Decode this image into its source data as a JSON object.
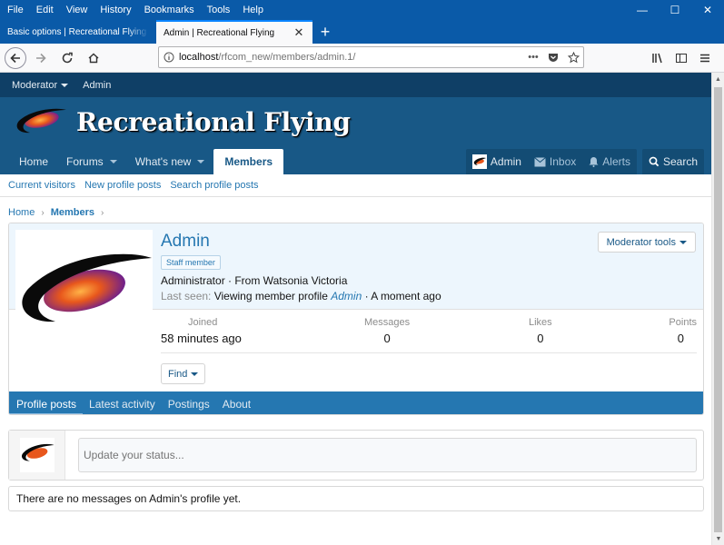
{
  "browser": {
    "menu": [
      "File",
      "Edit",
      "View",
      "History",
      "Bookmarks",
      "Tools",
      "Help"
    ],
    "tabs": [
      {
        "title": "Basic options | Recreational Flying -",
        "active": false
      },
      {
        "title": "Admin | Recreational Flying",
        "active": true
      }
    ],
    "url_host": "localhost",
    "url_path": "/rfcom_new/members/admin.1/"
  },
  "site": {
    "staff_bar": {
      "moderator": "Moderator",
      "admin": "Admin"
    },
    "title": "Recreational Flying",
    "nav": [
      {
        "label": "Home",
        "caret": false,
        "active": false
      },
      {
        "label": "Forums",
        "caret": true,
        "active": false
      },
      {
        "label": "What's new",
        "caret": true,
        "active": false
      },
      {
        "label": "Members",
        "caret": false,
        "active": true
      }
    ],
    "user_nav": {
      "admin": "Admin",
      "inbox": "Inbox",
      "alerts": "Alerts",
      "search": "Search"
    },
    "subnav": [
      "Current visitors",
      "New profile posts",
      "Search profile posts"
    ],
    "breadcrumb": [
      "Home",
      "Members"
    ]
  },
  "profile": {
    "name": "Admin",
    "badge": "Staff member",
    "line1": "Administrator · From Watsonia Victoria",
    "last_seen_label": "Last seen:",
    "last_seen_activity": "Viewing member profile",
    "last_seen_link": "Admin",
    "last_seen_time": "· A moment ago",
    "moderator_tools": "Moderator tools",
    "stats": {
      "joined_label": "Joined",
      "joined_value": "58 minutes ago",
      "messages_label": "Messages",
      "messages_value": "0",
      "likes_label": "Likes",
      "likes_value": "0",
      "points_label": "Points",
      "points_value": "0"
    },
    "find": "Find",
    "tabs": [
      "Profile posts",
      "Latest activity",
      "Postings",
      "About"
    ]
  },
  "status": {
    "placeholder": "Update your status..."
  },
  "empty_message": "There are no messages on Admin's profile yet.",
  "colors": {
    "header": "#185886",
    "staff_bar": "#0f3f66",
    "link": "#2577b1",
    "tabs": "#2577b1"
  }
}
